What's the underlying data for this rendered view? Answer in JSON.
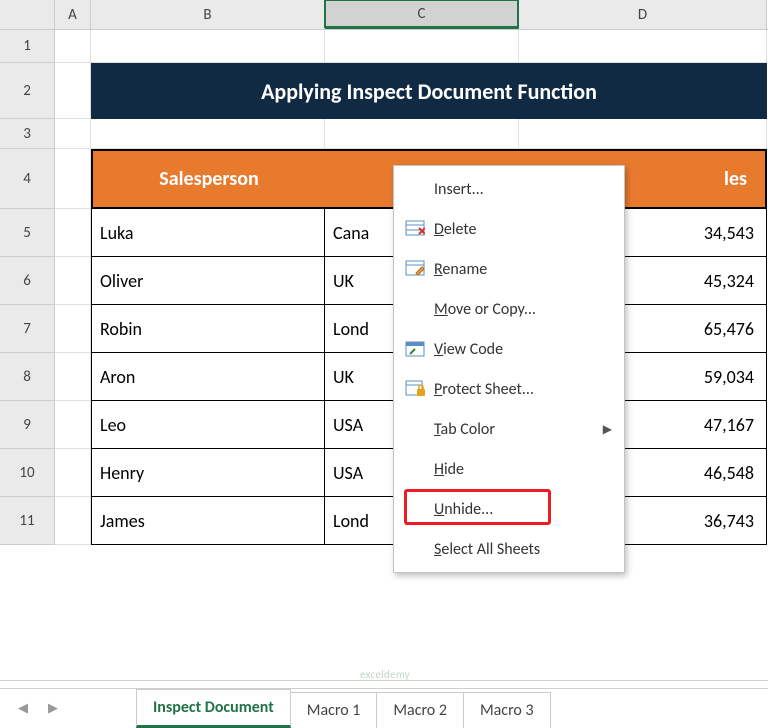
{
  "columns": {
    "a": "A",
    "b": "B",
    "c": "C",
    "d": "D"
  },
  "rows": [
    "1",
    "2",
    "3",
    "4",
    "5",
    "6",
    "7",
    "8",
    "9",
    "10",
    "11"
  ],
  "title": "Applying Inspect Document Function",
  "headers": {
    "salesperson": "Salesperson",
    "sales_label_suffix": "les"
  },
  "data": [
    {
      "name": "Luka",
      "region_visible": "Cana",
      "sales": "34,543"
    },
    {
      "name": "Oliver",
      "region_visible": "UK",
      "sales": "45,324"
    },
    {
      "name": "Robin",
      "region_visible": "Lond",
      "sales": "65,476"
    },
    {
      "name": "Aron",
      "region_visible": "UK",
      "sales": "59,034"
    },
    {
      "name": "Leo",
      "region_visible": "USA",
      "sales": "47,167"
    },
    {
      "name": "Henry",
      "region_visible": "USA",
      "sales": "46,548"
    },
    {
      "name": "James",
      "region_visible": "Lond",
      "sales": "36,743"
    }
  ],
  "menu": {
    "insert": "Insert...",
    "delete_pre": "",
    "delete_u": "D",
    "delete_post": "elete",
    "rename_pre": "",
    "rename_u": "R",
    "rename_post": "ename",
    "move_pre": "",
    "move_u": "M",
    "move_post": "ove or Copy...",
    "view_pre": "",
    "view_u": "V",
    "view_post": "iew Code",
    "protect_pre": "",
    "protect_u": "P",
    "protect_post": "rotect Sheet...",
    "tabcolor_pre": "",
    "tabcolor_u": "T",
    "tabcolor_post": "ab Color",
    "hide_pre": "",
    "hide_u": "H",
    "hide_post": "ide",
    "unhide_pre": "",
    "unhide_u": "U",
    "unhide_post": "nhide...",
    "selectall_pre": "",
    "selectall_u": "S",
    "selectall_post": "elect All Sheets"
  },
  "tabs": {
    "active": "Inspect Document",
    "t2": "Macro 1",
    "t3": "Macro 2",
    "t4": "Macro 3"
  },
  "watermark": "exceldemy"
}
